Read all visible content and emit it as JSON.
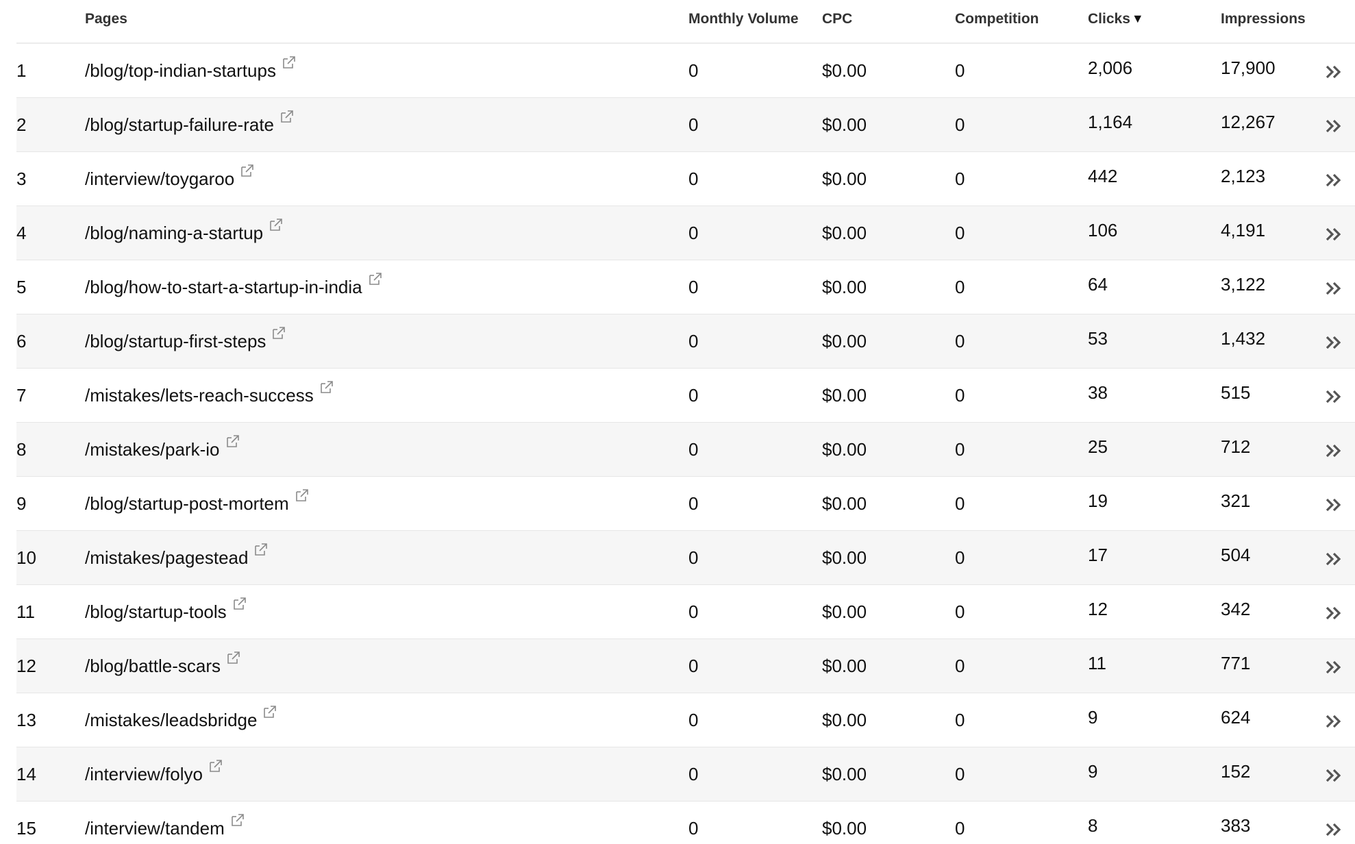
{
  "columns": {
    "pages": "Pages",
    "monthly_volume": "Monthly Volume",
    "cpc": "CPC",
    "competition": "Competition",
    "clicks": "Clicks",
    "impressions": "Impressions"
  },
  "sort": {
    "column": "clicks",
    "direction": "descending",
    "indicator": "▼"
  },
  "rows": [
    {
      "rank": "1",
      "page": "/blog/top-indian-startups",
      "monthly_volume": "0",
      "cpc": "$0.00",
      "competition": "0",
      "clicks": "2,006",
      "impressions": "17,900"
    },
    {
      "rank": "2",
      "page": "/blog/startup-failure-rate",
      "monthly_volume": "0",
      "cpc": "$0.00",
      "competition": "0",
      "clicks": "1,164",
      "impressions": "12,267"
    },
    {
      "rank": "3",
      "page": "/interview/toygaroo",
      "monthly_volume": "0",
      "cpc": "$0.00",
      "competition": "0",
      "clicks": "442",
      "impressions": "2,123"
    },
    {
      "rank": "4",
      "page": "/blog/naming-a-startup",
      "monthly_volume": "0",
      "cpc": "$0.00",
      "competition": "0",
      "clicks": "106",
      "impressions": "4,191"
    },
    {
      "rank": "5",
      "page": "/blog/how-to-start-a-startup-in-india",
      "monthly_volume": "0",
      "cpc": "$0.00",
      "competition": "0",
      "clicks": "64",
      "impressions": "3,122"
    },
    {
      "rank": "6",
      "page": "/blog/startup-first-steps",
      "monthly_volume": "0",
      "cpc": "$0.00",
      "competition": "0",
      "clicks": "53",
      "impressions": "1,432"
    },
    {
      "rank": "7",
      "page": "/mistakes/lets-reach-success",
      "monthly_volume": "0",
      "cpc": "$0.00",
      "competition": "0",
      "clicks": "38",
      "impressions": "515"
    },
    {
      "rank": "8",
      "page": "/mistakes/park-io",
      "monthly_volume": "0",
      "cpc": "$0.00",
      "competition": "0",
      "clicks": "25",
      "impressions": "712"
    },
    {
      "rank": "9",
      "page": "/blog/startup-post-mortem",
      "monthly_volume": "0",
      "cpc": "$0.00",
      "competition": "0",
      "clicks": "19",
      "impressions": "321"
    },
    {
      "rank": "10",
      "page": "/mistakes/pagestead",
      "monthly_volume": "0",
      "cpc": "$0.00",
      "competition": "0",
      "clicks": "17",
      "impressions": "504"
    },
    {
      "rank": "11",
      "page": "/blog/startup-tools",
      "monthly_volume": "0",
      "cpc": "$0.00",
      "competition": "0",
      "clicks": "12",
      "impressions": "342"
    },
    {
      "rank": "12",
      "page": "/blog/battle-scars",
      "monthly_volume": "0",
      "cpc": "$0.00",
      "competition": "0",
      "clicks": "11",
      "impressions": "771"
    },
    {
      "rank": "13",
      "page": "/mistakes/leadsbridge",
      "monthly_volume": "0",
      "cpc": "$0.00",
      "competition": "0",
      "clicks": "9",
      "impressions": "624"
    },
    {
      "rank": "14",
      "page": "/interview/folyo",
      "monthly_volume": "0",
      "cpc": "$0.00",
      "competition": "0",
      "clicks": "9",
      "impressions": "152"
    },
    {
      "rank": "15",
      "page": "/interview/tandem",
      "monthly_volume": "0",
      "cpc": "$0.00",
      "competition": "0",
      "clicks": "8",
      "impressions": "383"
    }
  ],
  "icons": {
    "external_link": "external-link-icon",
    "row_details": "double-chevron-right-icon"
  },
  "colors": {
    "text": "#111111",
    "header_text": "#333333",
    "alt_row_bg": "#f6f6f6",
    "border": "#e6e6e6",
    "icon": "#8a8a8a"
  }
}
